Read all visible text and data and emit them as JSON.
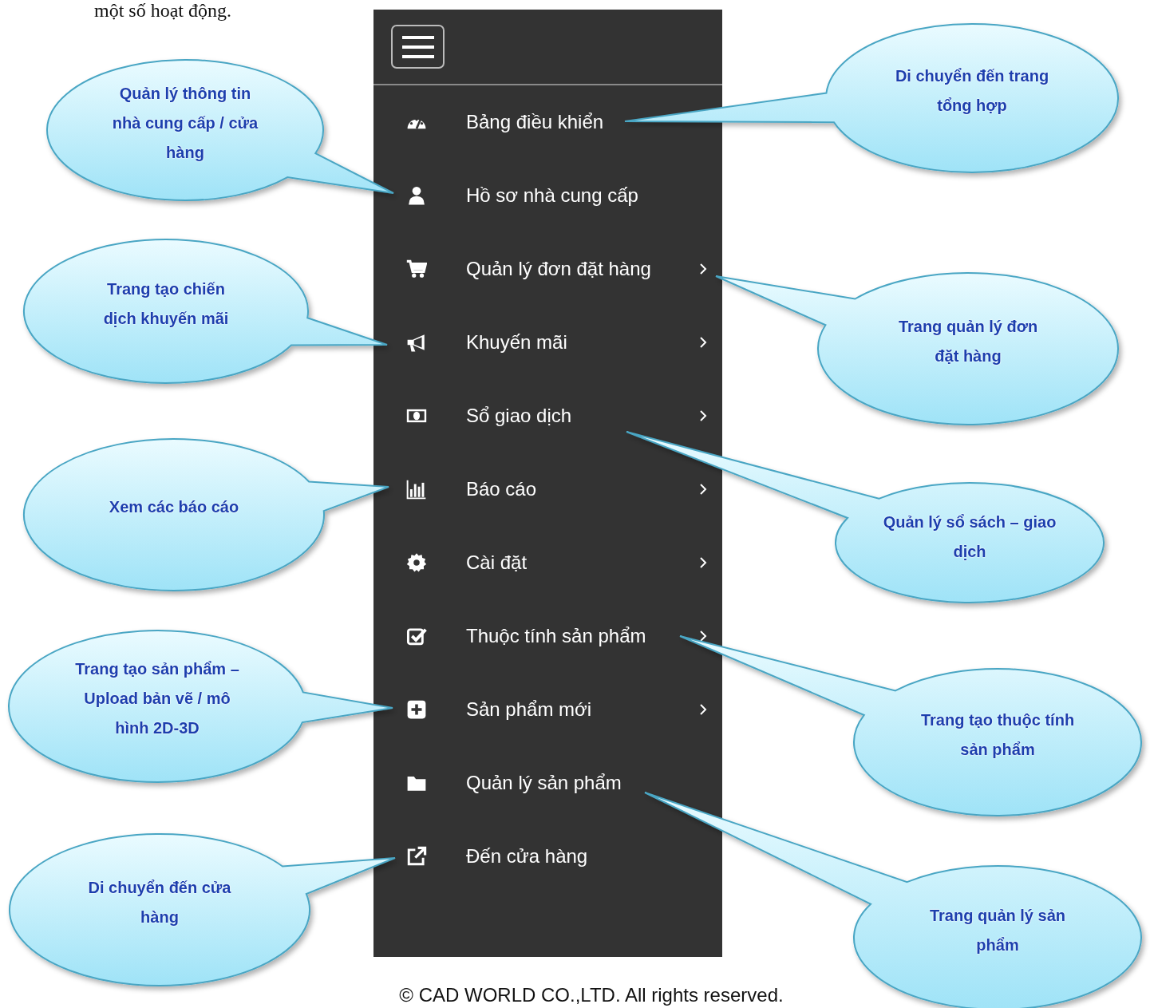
{
  "intro_text": "một số hoạt động.",
  "sidebar": {
    "items": [
      {
        "label": "Bảng điều khiển",
        "has_submenu": false
      },
      {
        "label": "Hồ sơ nhà cung cấp",
        "has_submenu": false
      },
      {
        "label": "Quản lý đơn đặt hàng",
        "has_submenu": true
      },
      {
        "label": "Khuyến mãi",
        "has_submenu": true
      },
      {
        "label": "Sổ giao dịch",
        "has_submenu": true
      },
      {
        "label": "Báo cáo",
        "has_submenu": true
      },
      {
        "label": "Cài đặt",
        "has_submenu": true
      },
      {
        "label": "Thuộc tính sản phẩm",
        "has_submenu": true
      },
      {
        "label": "Sản phẩm mới",
        "has_submenu": true
      },
      {
        "label": "Quản lý sản phẩm",
        "has_submenu": false
      },
      {
        "label": "Đến cửa hàng",
        "has_submenu": false
      }
    ]
  },
  "callouts": [
    {
      "text": "Quản lý thông tin nhà cung cấp / cửa hàng"
    },
    {
      "text": "Trang tạo chiến dịch khuyến mãi"
    },
    {
      "text": "Xem các báo cáo"
    },
    {
      "text": "Trang tạo sản phẩm – Upload bản vẽ / mô hình 2D-3D"
    },
    {
      "text": "Di chuyển đến cửa hàng"
    },
    {
      "text": "Di chuyển đến trang tổng hợp"
    },
    {
      "text": "Trang quản lý đơn đặt hàng"
    },
    {
      "text": "Quản lý sổ sách – giao dịch"
    },
    {
      "text": "Trang tạo thuộc tính sản phẩm"
    },
    {
      "text": "Trang quản lý sản phẩm"
    }
  ],
  "footer": "© CAD WORLD CO.,LTD. All rights reserved."
}
